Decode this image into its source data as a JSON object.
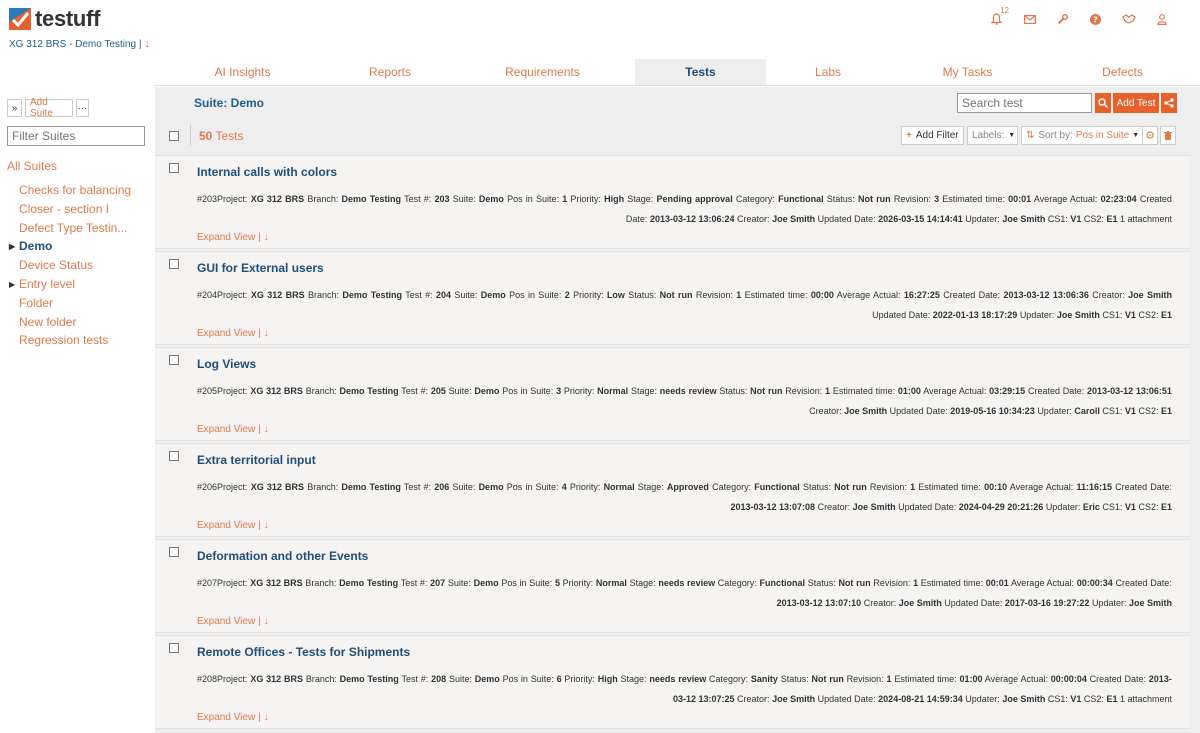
{
  "app": {
    "name": "testuff",
    "brand_color": "#e8612c",
    "link_color": "#1f4e79"
  },
  "header": {
    "project_line": "XG 312 BRS - Demo Testing |",
    "project_arrow": "↓",
    "notification_count": "12",
    "icons": [
      "bell-icon",
      "mail-icon",
      "wrench-icon",
      "help-icon",
      "handshake-icon",
      "user-icon"
    ]
  },
  "nav": {
    "tabs": [
      "AI Insights",
      "Reports",
      "Requirements",
      "Tests",
      "Labs",
      "My Tasks",
      "Defects"
    ],
    "active": "Tests"
  },
  "sidebar": {
    "expand_label": "»",
    "add_suite_label": "Add Suite",
    "more_label": "···",
    "filter_placeholder": "Filter Suites",
    "all_label": "All Suites",
    "items": [
      {
        "label": "Checks for balancing"
      },
      {
        "label": "Closer - section I"
      },
      {
        "label": "Defect Type Testin..."
      },
      {
        "label": "Demo",
        "active": true,
        "expandable": true
      },
      {
        "label": "Device Status"
      },
      {
        "label": "Entry level",
        "expandable": true
      },
      {
        "label": "Folder"
      },
      {
        "label": "New folder"
      },
      {
        "label": "Regression tests"
      }
    ]
  },
  "main": {
    "suite_title": "Suite: Demo",
    "search_placeholder": "Search test",
    "add_test_label": "Add Test",
    "count_number": "50",
    "count_label": "Tests",
    "add_filter_label": "Add Filter",
    "labels_label": "Labels:",
    "sort_prefix": "Sort by:",
    "sort_value": "Pos in Suite"
  },
  "tests": [
    {
      "title": "Internal calls with colors",
      "id": "#203",
      "fields": [
        [
          "Project:",
          "XG 312 BRS"
        ],
        [
          "Branch:",
          "Demo Testing"
        ],
        [
          "Test #:",
          "203"
        ],
        [
          "Suite:",
          "Demo"
        ],
        [
          "Pos in Suite:",
          "1"
        ],
        [
          "Priority:",
          "High"
        ],
        [
          "Stage:",
          "Pending approval"
        ],
        [
          "Category:",
          "Functional"
        ],
        [
          "Status:",
          "Not run"
        ],
        [
          "Revision:",
          "3"
        ],
        [
          "Estimated time:",
          "00:01"
        ],
        [
          "Average Actual:",
          "02:23:04"
        ],
        [
          "Created Date:",
          "2013-03-12 13:06:24"
        ],
        [
          "Creator:",
          "Joe Smith"
        ],
        [
          "Updated Date:",
          "2026-03-15 14:14:41"
        ],
        [
          "Updater:",
          "Joe Smith"
        ],
        [
          "CS1:",
          "V1"
        ],
        [
          "CS2:",
          "E1"
        ]
      ],
      "attachments": "1 attachment",
      "expand": "Expand View |"
    },
    {
      "title": "GUI for External users",
      "id": "#204",
      "fields": [
        [
          "Project:",
          "XG 312 BRS"
        ],
        [
          "Branch:",
          "Demo Testing"
        ],
        [
          "Test #:",
          "204"
        ],
        [
          "Suite:",
          "Demo"
        ],
        [
          "Pos in Suite:",
          "2"
        ],
        [
          "Priority:",
          "Low"
        ],
        [
          "Status:",
          "Not run"
        ],
        [
          "Revision:",
          "1"
        ],
        [
          "Estimated time:",
          "00:00"
        ],
        [
          "Average Actual:",
          "16:27:25"
        ],
        [
          "Created Date:",
          "2013-03-12 13:06:36"
        ],
        [
          "Creator:",
          "Joe Smith"
        ],
        [
          "Updated Date:",
          "2022-01-13 18:17:29"
        ],
        [
          "Updater:",
          "Joe Smith"
        ],
        [
          "CS1:",
          "V1"
        ],
        [
          "CS2:",
          "E1"
        ]
      ],
      "attachments": "",
      "expand": "Expand View |"
    },
    {
      "title": "Log Views",
      "id": "#205",
      "fields": [
        [
          "Project:",
          "XG 312 BRS"
        ],
        [
          "Branch:",
          "Demo Testing"
        ],
        [
          "Test #:",
          "205"
        ],
        [
          "Suite:",
          "Demo"
        ],
        [
          "Pos in Suite:",
          "3"
        ],
        [
          "Priority:",
          "Normal"
        ],
        [
          "Stage:",
          "needs review"
        ],
        [
          "Status:",
          "Not run"
        ],
        [
          "Revision:",
          "1"
        ],
        [
          "Estimated time:",
          "01:00"
        ],
        [
          "Average Actual:",
          "03:29:15"
        ],
        [
          "Created Date:",
          "2013-03-12 13:06:51"
        ],
        [
          "Creator:",
          "Joe Smith"
        ],
        [
          "Updated Date:",
          "2019-05-16 10:34:23"
        ],
        [
          "Updater:",
          "Caroll"
        ],
        [
          "CS1:",
          "V1"
        ],
        [
          "CS2:",
          "E1"
        ]
      ],
      "attachments": "",
      "expand": "Expand View |"
    },
    {
      "title": "Extra territorial input",
      "id": "#206",
      "fields": [
        [
          "Project:",
          "XG 312 BRS"
        ],
        [
          "Branch:",
          "Demo Testing"
        ],
        [
          "Test #:",
          "206"
        ],
        [
          "Suite:",
          "Demo"
        ],
        [
          "Pos in Suite:",
          "4"
        ],
        [
          "Priority:",
          "Normal"
        ],
        [
          "Stage:",
          "Approved"
        ],
        [
          "Category:",
          "Functional"
        ],
        [
          "Status:",
          "Not run"
        ],
        [
          "Revision:",
          "1"
        ],
        [
          "Estimated time:",
          "00:10"
        ],
        [
          "Average Actual:",
          "11:16:15"
        ],
        [
          "Created Date:",
          "2013-03-12 13:07:08"
        ],
        [
          "Creator:",
          "Joe Smith"
        ],
        [
          "Updated Date:",
          "2024-04-29 20:21:26"
        ],
        [
          "Updater:",
          "Eric"
        ],
        [
          "CS1:",
          "V1"
        ],
        [
          "CS2:",
          "E1"
        ]
      ],
      "attachments": "",
      "expand": "Expand View |"
    },
    {
      "title": "Deformation and other Events",
      "id": "#207",
      "fields": [
        [
          "Project:",
          "XG 312 BRS"
        ],
        [
          "Branch:",
          "Demo Testing"
        ],
        [
          "Test #:",
          "207"
        ],
        [
          "Suite:",
          "Demo"
        ],
        [
          "Pos in Suite:",
          "5"
        ],
        [
          "Priority:",
          "Normal"
        ],
        [
          "Stage:",
          "needs review"
        ],
        [
          "Category:",
          "Functional"
        ],
        [
          "Status:",
          "Not run"
        ],
        [
          "Revision:",
          "1"
        ],
        [
          "Estimated time:",
          "00:01"
        ],
        [
          "Average Actual:",
          "00:00:34"
        ],
        [
          "Created Date:",
          "2013-03-12 13:07:10"
        ],
        [
          "Creator:",
          "Joe Smith"
        ],
        [
          "Updated Date:",
          "2017-03-16 19:27:22"
        ],
        [
          "Updater:",
          "Joe Smith"
        ]
      ],
      "attachments": "",
      "expand": "Expand View |"
    },
    {
      "title": "Remote Offices - Tests for Shipments",
      "id": "#208",
      "fields": [
        [
          "Project:",
          "XG 312 BRS"
        ],
        [
          "Branch:",
          "Demo Testing"
        ],
        [
          "Test #:",
          "208"
        ],
        [
          "Suite:",
          "Demo"
        ],
        [
          "Pos in Suite:",
          "6"
        ],
        [
          "Priority:",
          "High"
        ],
        [
          "Stage:",
          "needs review"
        ],
        [
          "Category:",
          "Sanity"
        ],
        [
          "Status:",
          "Not run"
        ],
        [
          "Revision:",
          "1"
        ],
        [
          "Estimated time:",
          "01:00"
        ],
        [
          "Average Actual:",
          "00:00:04"
        ],
        [
          "Created Date:",
          "2013-03-12 13:07:25"
        ],
        [
          "Creator:",
          "Joe Smith"
        ],
        [
          "Updated Date:",
          "2024-08-21 14:59:34"
        ],
        [
          "Updater:",
          "Joe Smith"
        ],
        [
          "CS1:",
          "V1"
        ],
        [
          "CS2:",
          "E1"
        ]
      ],
      "attachments": "1 attachment",
      "expand": "Expand View |"
    }
  ]
}
